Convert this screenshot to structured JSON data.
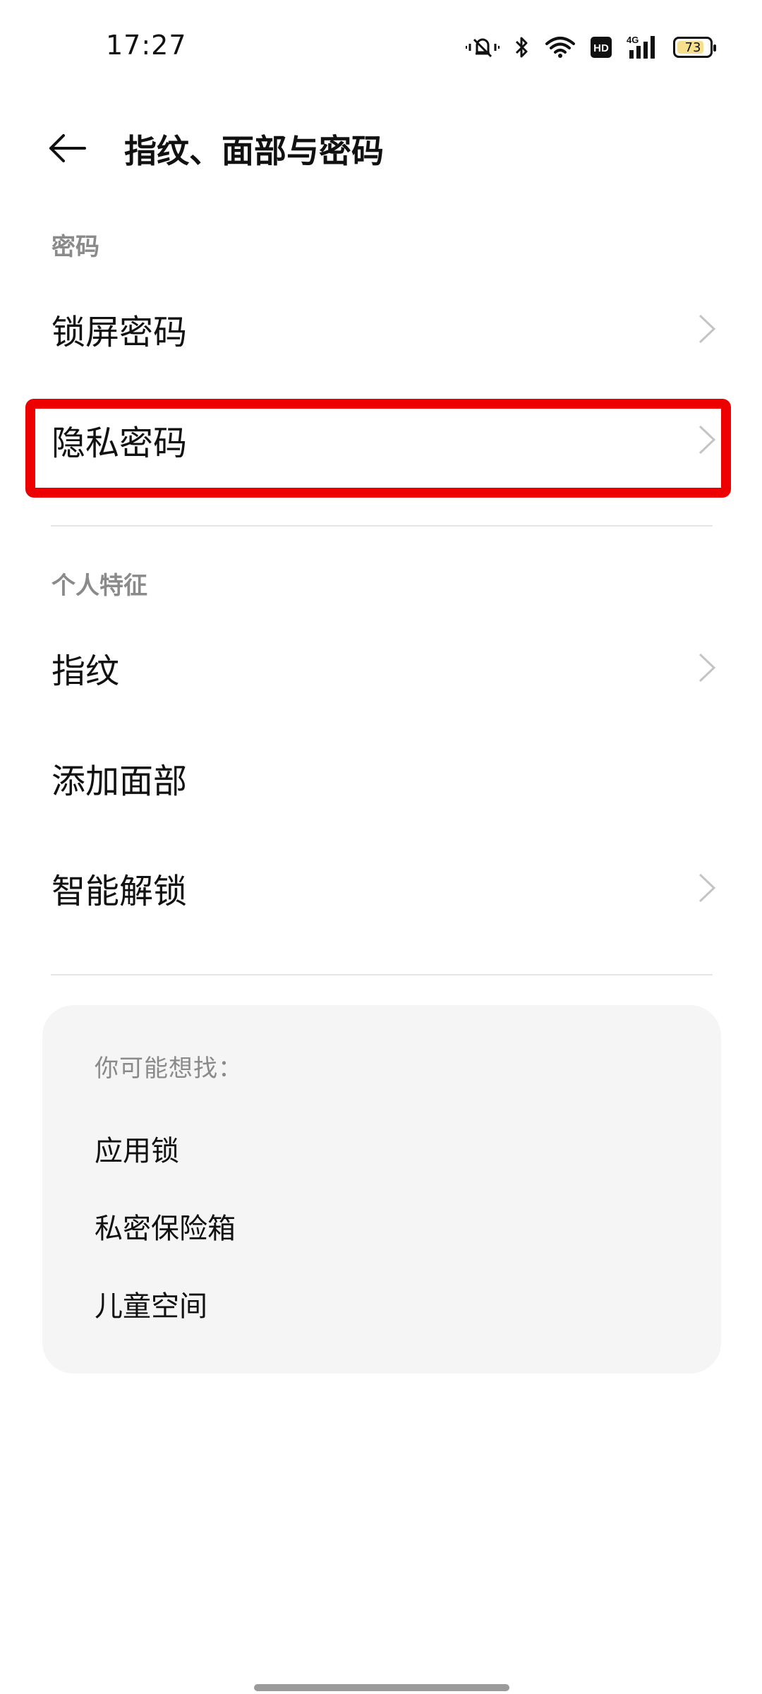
{
  "status_bar": {
    "time": "17:27",
    "battery_level": "73",
    "icons": [
      "vibrate-silent-icon",
      "bluetooth-icon",
      "wifi-icon",
      "hd-icon",
      "4g-signal-icon",
      "battery-icon"
    ]
  },
  "header": {
    "title": "指纹、面部与密码",
    "back_icon": "back-arrow-icon"
  },
  "sections": {
    "password": {
      "label": "密码",
      "items": [
        {
          "label": "锁屏密码"
        },
        {
          "label": "隐私密码"
        }
      ]
    },
    "biometrics": {
      "label": "个人特征",
      "items": [
        {
          "label": "指纹"
        },
        {
          "label": "添加面部"
        },
        {
          "label": "智能解锁"
        }
      ]
    }
  },
  "suggestions": {
    "title": "你可能想找：",
    "items": [
      "应用锁",
      "私密保险箱",
      "儿童空间"
    ]
  },
  "colors": {
    "highlight": "#ee0000",
    "section_label": "#8a8a8a",
    "card_background": "#f5f5f5"
  }
}
